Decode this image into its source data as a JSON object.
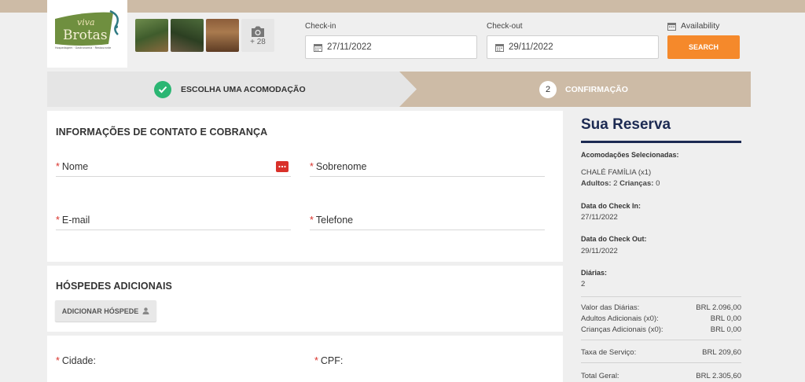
{
  "logo": {
    "line1": "viva",
    "line2": "Brotas",
    "tagline": "Hospedagem · Gastronomia · Restaurante"
  },
  "gallery": {
    "more_count": "+ 28"
  },
  "search": {
    "checkin_label": "Check-in",
    "checkin_value": "27/11/2022",
    "checkout_label": "Check-out",
    "checkout_value": "29/11/2022",
    "availability_label": "Availability",
    "search_button": "SEARCH"
  },
  "steps": [
    {
      "label": "ESCOLHA UMA ACOMODAÇÃO",
      "state": "done"
    },
    {
      "number": "2",
      "label": "CONFIRMAÇÃO",
      "state": "current"
    }
  ],
  "contact": {
    "title": "INFORMAÇÕES DE CONTATO E COBRANÇA",
    "required_mark": "*",
    "fields": {
      "nome": "Nome",
      "sobrenome": "Sobrenome",
      "email": "E-mail",
      "telefone": "Telefone"
    }
  },
  "guests": {
    "title": "HÓSPEDES ADICIONAIS",
    "add_button": "ADICIONAR HÓSPEDE"
  },
  "address": {
    "cidade": "Cidade:",
    "cpf": "CPF:"
  },
  "summary": {
    "title": "Sua Reserva",
    "accommodations_label": "Acomodações Selecionadas:",
    "accommodation": "CHALÉ FAMÍLIA (x1)",
    "adults_label": "Adultos:",
    "adults": "2",
    "children_label": "Crianças:",
    "children": "0",
    "checkin_label": "Data do Check In:",
    "checkin": "27/11/2022",
    "checkout_label": "Data do Check Out:",
    "checkout": "29/11/2022",
    "nights_label": "Diárias:",
    "nights": "2",
    "lines": [
      {
        "label": "Valor das Diárias:",
        "value": "BRL 2.096,00"
      },
      {
        "label": "Adultos Adicionais (x0):",
        "value": "BRL 0,00"
      },
      {
        "label": "Crianças Adicionais (x0):",
        "value": "BRL 0,00"
      }
    ],
    "fee_label": "Taxa de Serviço:",
    "fee": "BRL 209,60",
    "total_label": "Total Geral:",
    "total": "BRL 2.305,60"
  },
  "colors": {
    "accent": "#f5892b",
    "tan": "#cdbba6",
    "navy": "#1c2a52",
    "success": "#2bb673",
    "required": "#d9312a"
  }
}
